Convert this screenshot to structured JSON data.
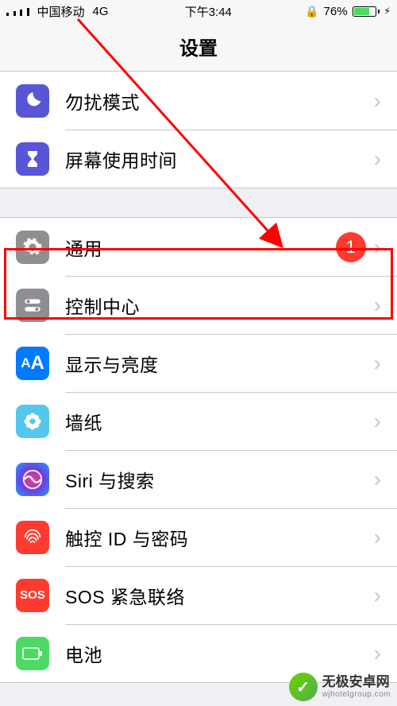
{
  "status_bar": {
    "carrier": "中国移动",
    "network": "4G",
    "time": "下午3:44",
    "orientation_lock": true,
    "battery_percent": "76%",
    "battery_fill_width": "76%",
    "charging": true
  },
  "nav": {
    "title": "设置"
  },
  "groups": [
    {
      "rows": [
        {
          "id": "dnd",
          "label": "勿扰模式",
          "icon": "moon-icon",
          "badge": null
        },
        {
          "id": "screentime",
          "label": "屏幕使用时间",
          "icon": "hourglass-icon",
          "badge": null
        }
      ]
    },
    {
      "rows": [
        {
          "id": "general",
          "label": "通用",
          "icon": "gear-icon",
          "badge": "1"
        },
        {
          "id": "control-center",
          "label": "控制中心",
          "icon": "toggles-icon",
          "badge": null
        },
        {
          "id": "display",
          "label": "显示与亮度",
          "icon": "text-size-icon",
          "badge": null
        },
        {
          "id": "wallpaper",
          "label": "墙纸",
          "icon": "flower-icon",
          "badge": null
        },
        {
          "id": "siri",
          "label": "Siri 与搜索",
          "icon": "siri-icon",
          "badge": null
        },
        {
          "id": "touchid",
          "label": "触控 ID 与密码",
          "icon": "fingerprint-icon",
          "badge": null
        },
        {
          "id": "sos",
          "label": "SOS 紧急联络",
          "icon": "sos-icon",
          "badge": null
        },
        {
          "id": "battery",
          "label": "电池",
          "icon": "battery-icon",
          "badge": null
        }
      ]
    }
  ],
  "annotation": {
    "highlighted_row": "general",
    "arrow_from": "top-left",
    "arrow_to": "general-row"
  },
  "watermark": {
    "title": "无极安卓网",
    "url": "wjhotelgroup.com"
  }
}
